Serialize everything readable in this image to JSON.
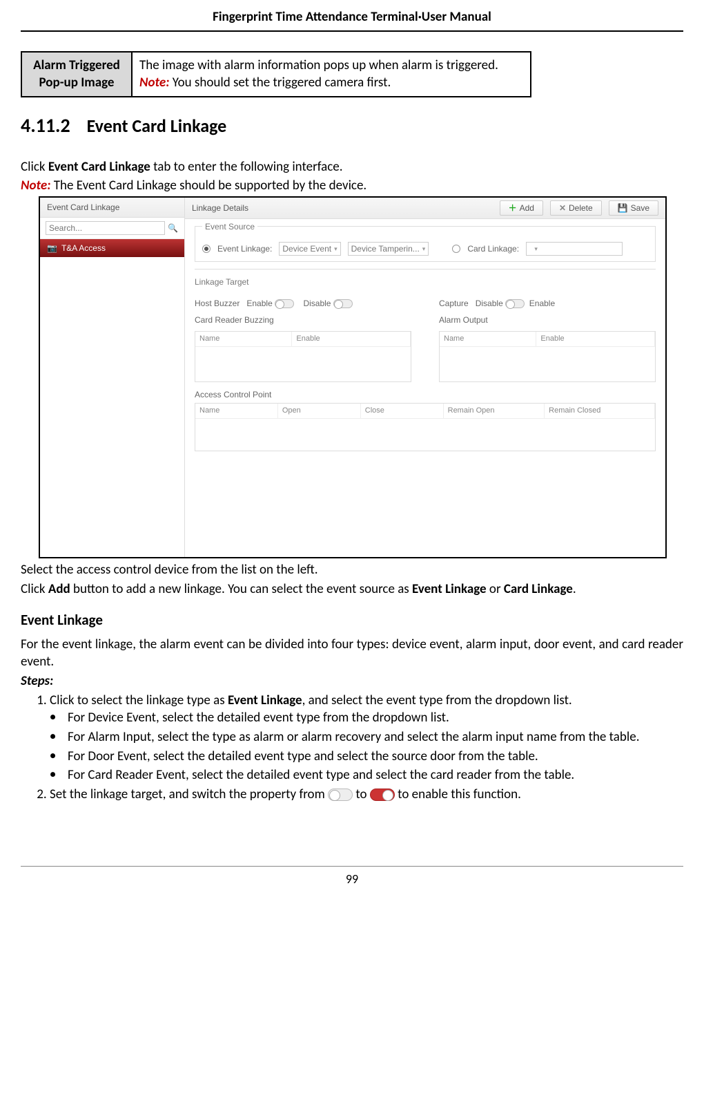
{
  "header": {
    "title": "Fingerprint Time Attendance Terminal·User Manual"
  },
  "infoBox": {
    "label_l1": "Alarm Triggered",
    "label_l2": "Pop-up Image",
    "desc": "The image with alarm information pops up when alarm is triggered.",
    "note_label": "Note:",
    "note_text": " You should set the triggered camera first."
  },
  "section": {
    "num": "4.11.2",
    "title": "Event Card Linkage"
  },
  "intro": {
    "p1a": "Click ",
    "p1b": "Event Card Linkage",
    "p1c": " tab to enter the following interface.",
    "note_label": "Note:",
    "note_text": " The Event Card Linkage should be supported by the device."
  },
  "ui": {
    "side_header": "Event Card Linkage",
    "search_placeholder": "Search...",
    "side_item": "T&A Access",
    "main_header": "Linkage Details",
    "btn_add": "Add",
    "btn_delete": "Delete",
    "btn_save": "Save",
    "panel_source": "Event Source",
    "event_linkage_label": "Event Linkage:",
    "sel_device_event": "Device Event",
    "sel_device_tamper": "Device Tamperin...",
    "card_linkage_label": "Card Linkage:",
    "panel_target": "Linkage Target",
    "host_buzzer": "Host Buzzer",
    "enable": "Enable",
    "disable": "Disable",
    "capture": "Capture",
    "card_reader_buzzing": "Card Reader Buzzing",
    "alarm_output": "Alarm Output",
    "th_name": "Name",
    "th_enable": "Enable",
    "access_point": "Access Control Point",
    "th_open": "Open",
    "th_close": "Close",
    "th_remain_open": "Remain Open",
    "th_remain_closed": "Remain Closed"
  },
  "after": {
    "p1": "Select the access control device from the list on the left.",
    "p2a": "Click ",
    "p2b": "Add",
    "p2c": " button to add a new linkage. You can select the event source as ",
    "p2d": "Event Linkage",
    "p2e": " or ",
    "p2f": "Card Linkage",
    "p2g": "."
  },
  "eventLinkage": {
    "heading": "Event Linkage",
    "desc": "For the event linkage, the alarm event can be divided into four types: device event, alarm input, door event, and card reader event.",
    "steps_label": "Steps:",
    "s1a": "Click to select the linkage type as ",
    "s1b": "Event Linkage",
    "s1c": ", and select the event type from the dropdown list.",
    "b1": "For Device Event, select the detailed event type from the dropdown list.",
    "b2": "For Alarm Input, select the type as alarm or alarm recovery and select the alarm input name from the table.",
    "b3": "For Door Event, select the detailed event type and select the source door from the table.",
    "b4": "For Card Reader Event, select the detailed event type and select the card reader from the table.",
    "s2a": "Set the linkage target, and switch the property from ",
    "s2b": " to ",
    "s2c": " to enable this function."
  },
  "page_num": "99"
}
